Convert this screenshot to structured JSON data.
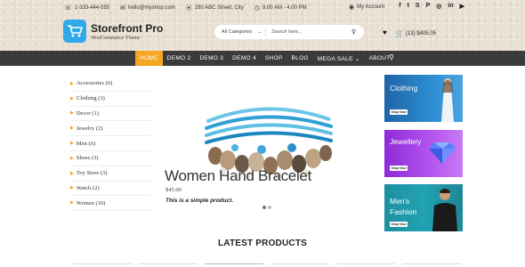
{
  "topbar": {
    "phone": "1-333-444-555",
    "email": "hello@myshop.com",
    "address": "280 ABC Street, City",
    "hours": "8.00 AM - 4.00 PM",
    "account": "My Account",
    "social_icons": [
      "facebook-icon",
      "twitter-icon",
      "skype-icon",
      "pinterest-icon",
      "instagram-icon",
      "linkedin-icon",
      "youtube-icon"
    ]
  },
  "brand": {
    "name": "Storefront Pro",
    "tagline": "WooCommerce Theme",
    "logo_color": "#2fa9e7"
  },
  "search": {
    "category": "All Categories",
    "placeholder": "Search here..."
  },
  "cart": {
    "summary": "(13)  $405.05"
  },
  "nav": {
    "items": [
      {
        "label": "HOME",
        "active": true
      },
      {
        "label": "DEMO 2"
      },
      {
        "label": "DEMO 3"
      },
      {
        "label": "DEMO 4"
      },
      {
        "label": "SHOP"
      },
      {
        "label": "BLOG"
      },
      {
        "label": "MEGA SALE ⌄"
      },
      {
        "label": "ABOUT"
      }
    ],
    "bar_color": "#3b3b3b",
    "active_color": "#f5a623"
  },
  "sidebar": {
    "categories": [
      "Accessories (6)",
      "Clothing (3)",
      "Decor (1)",
      "Jewelry (2)",
      "Men (6)",
      "Shoes (3)",
      "Toy Store (3)",
      "Watch (2)",
      "Women (10)"
    ]
  },
  "slider": {
    "title": "Women Hand Bracelet",
    "price": "$45.00",
    "description": "This is a simple product.",
    "active_slide": 1,
    "total_slides": 2
  },
  "banners": [
    {
      "title": "Clothing",
      "button": "Shop Now"
    },
    {
      "title": "Jewellery",
      "button": "Shop Now"
    },
    {
      "title_line1": "Men's",
      "title_line2": "Fashion",
      "button": "Shop Now"
    }
  ],
  "section": {
    "latest_title": "LATEST PRODUCTS"
  }
}
